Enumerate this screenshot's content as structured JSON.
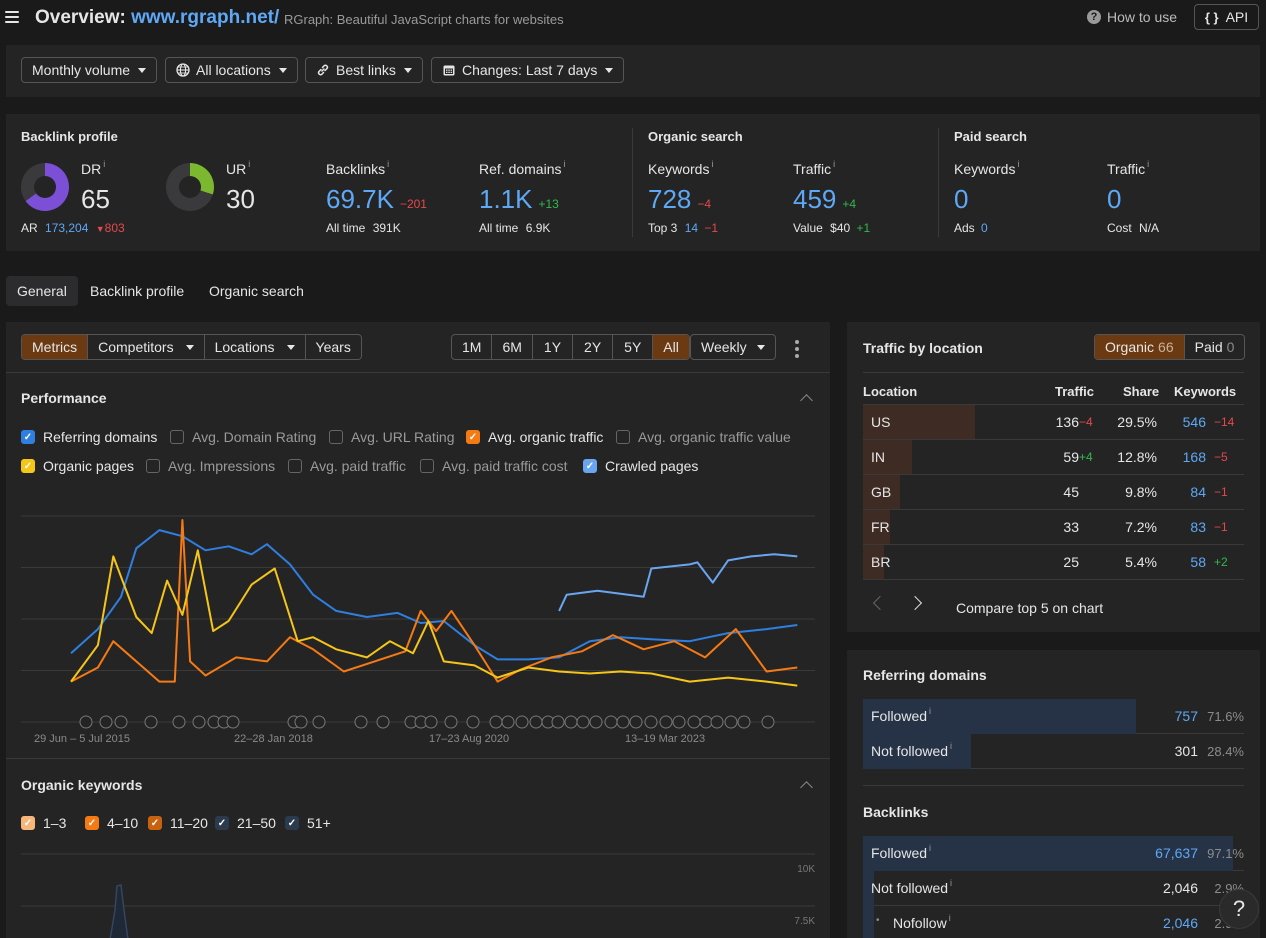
{
  "header": {
    "title_prefix": "Overview: ",
    "url": "www.rgraph.net/",
    "subtitle": "RGraph: Beautiful JavaScript charts for websites",
    "how_to_use": "How to use",
    "api": "API"
  },
  "filters": {
    "volume": "Monthly volume",
    "locations": "All locations",
    "links": "Best links",
    "changes": "Changes: Last 7 days"
  },
  "backlink_profile": {
    "title": "Backlink profile",
    "dr": {
      "label": "DR",
      "value": "65",
      "fill": 0.65
    },
    "ar": {
      "label": "AR",
      "value": "173,204",
      "change": "803"
    },
    "ur": {
      "label": "UR",
      "value": "30",
      "fill": 0.3
    },
    "backlinks": {
      "label": "Backlinks",
      "value": "69.7K",
      "change": "−201",
      "sub_label": "All time",
      "sub_value": "391K"
    },
    "ref_domains": {
      "label": "Ref. domains",
      "value": "1.1K",
      "change": "+13",
      "sub_label": "All time",
      "sub_value": "6.9K"
    }
  },
  "organic_search": {
    "title": "Organic search",
    "keywords": {
      "label": "Keywords",
      "value": "728",
      "change": "−4",
      "sub_label": "Top 3",
      "sub_value": "14",
      "sub_change": "−1"
    },
    "traffic": {
      "label": "Traffic",
      "value": "459",
      "change": "+4",
      "sub_label": "Value",
      "sub_value": "$40",
      "sub_change": "+1"
    }
  },
  "paid_search": {
    "title": "Paid search",
    "keywords": {
      "label": "Keywords",
      "value": "0",
      "sub_label": "Ads",
      "sub_value": "0"
    },
    "traffic": {
      "label": "Traffic",
      "value": "0",
      "sub_label": "Cost",
      "sub_value": "N/A"
    }
  },
  "tabs": [
    "General",
    "Backlink profile",
    "Organic search"
  ],
  "chart_toolbar": {
    "modes": [
      "Metrics",
      "Competitors",
      "Locations",
      "Years"
    ],
    "ranges": [
      "1M",
      "6M",
      "1Y",
      "2Y",
      "5Y",
      "All"
    ],
    "active_range": "All",
    "interval": "Weekly"
  },
  "performance": {
    "title": "Performance",
    "metrics": [
      {
        "label": "Referring domains",
        "checked": true,
        "color": "#2f7fe0"
      },
      {
        "label": "Avg. Domain Rating",
        "checked": false
      },
      {
        "label": "Avg. URL Rating",
        "checked": false
      },
      {
        "label": "Avg. organic traffic",
        "checked": true,
        "color": "#f57a14"
      },
      {
        "label": "Avg. organic traffic value",
        "checked": false
      },
      {
        "label": "Organic pages",
        "checked": true,
        "color": "#f5c518"
      },
      {
        "label": "Avg. Impressions",
        "checked": false
      },
      {
        "label": "Avg. paid traffic",
        "checked": false
      },
      {
        "label": "Avg. paid traffic cost",
        "checked": false
      },
      {
        "label": "Crawled pages",
        "checked": true,
        "color": "#6aa6f0"
      }
    ]
  },
  "chart_data": {
    "type": "line",
    "title": "Performance",
    "x_tick_labels": [
      "29 Jun – 5 Jul 2015",
      "22–28 Jan 2018",
      "17–23 Aug 2020",
      "13–19 Mar 2023"
    ],
    "x_range": [
      2015.45,
      2025.0
    ],
    "y_range_normalized": [
      0,
      1
    ],
    "grid": true,
    "legend": "top",
    "series": [
      {
        "name": "Referring domains",
        "color": "#2f7fe0",
        "x": [
          2015.45,
          2015.8,
          2016.1,
          2016.3,
          2016.6,
          2016.9,
          2017.2,
          2017.5,
          2017.8,
          2018.0,
          2018.3,
          2018.6,
          2018.9,
          2019.3,
          2019.7,
          2020.0,
          2020.3,
          2020.7,
          2021.0,
          2021.4,
          2021.8,
          2022.2,
          2022.6,
          2023.0,
          2023.5,
          2024.0,
          2024.5,
          2024.9
        ],
        "y": [
          0.34,
          0.46,
          0.62,
          0.86,
          0.95,
          0.92,
          0.85,
          0.87,
          0.83,
          0.88,
          0.78,
          0.63,
          0.55,
          0.52,
          0.54,
          0.49,
          0.5,
          0.38,
          0.31,
          0.31,
          0.32,
          0.4,
          0.42,
          0.41,
          0.4,
          0.44,
          0.46,
          0.48
        ]
      },
      {
        "name": "Crawled pages",
        "color": "#6aa6f0",
        "x": [
          2021.8,
          2021.9,
          2022.3,
          2022.7,
          2022.9,
          2023.0,
          2023.5,
          2023.6,
          2023.8,
          2024.0,
          2024.3,
          2024.6,
          2024.9
        ],
        "y": [
          0.55,
          0.63,
          0.65,
          0.63,
          0.62,
          0.76,
          0.78,
          0.79,
          0.69,
          0.8,
          0.82,
          0.83,
          0.82
        ]
      },
      {
        "name": "Avg. organic traffic",
        "color": "#f57a14",
        "x": [
          2015.45,
          2015.8,
          2016.0,
          2016.3,
          2016.6,
          2016.8,
          2016.9,
          2017.0,
          2017.2,
          2017.6,
          2018.0,
          2018.3,
          2018.6,
          2019.0,
          2019.4,
          2019.8,
          2020.0,
          2020.2,
          2020.4,
          2020.7,
          2021.0,
          2021.3,
          2021.7,
          2022.1,
          2022.5,
          2022.9,
          2023.3,
          2023.7,
          2024.1,
          2024.5,
          2024.9
        ],
        "y": [
          0.2,
          0.27,
          0.4,
          0.3,
          0.2,
          0.2,
          1.0,
          0.3,
          0.23,
          0.32,
          0.3,
          0.42,
          0.36,
          0.25,
          0.3,
          0.35,
          0.55,
          0.45,
          0.55,
          0.38,
          0.2,
          0.26,
          0.32,
          0.35,
          0.43,
          0.36,
          0.4,
          0.32,
          0.46,
          0.25,
          0.27
        ]
      },
      {
        "name": "Organic pages",
        "color": "#f5c518",
        "x": [
          2015.45,
          2015.8,
          2016.0,
          2016.3,
          2016.5,
          2016.7,
          2016.9,
          2017.1,
          2017.3,
          2017.5,
          2017.8,
          2018.1,
          2018.4,
          2018.6,
          2018.9,
          2019.3,
          2019.6,
          2019.9,
          2020.1,
          2020.3,
          2020.7,
          2021.0,
          2021.4,
          2021.8,
          2022.2,
          2022.6,
          2023.0,
          2023.5,
          2024.0,
          2024.5,
          2024.9
        ],
        "y": [
          0.2,
          0.38,
          0.82,
          0.52,
          0.44,
          0.7,
          0.53,
          0.85,
          0.45,
          0.5,
          0.68,
          0.76,
          0.4,
          0.42,
          0.36,
          0.32,
          0.4,
          0.34,
          0.5,
          0.3,
          0.28,
          0.22,
          0.27,
          0.25,
          0.24,
          0.25,
          0.24,
          0.2,
          0.22,
          0.2,
          0.18
        ]
      }
    ]
  },
  "organic_keywords": {
    "title": "Organic keywords",
    "filters": [
      {
        "label": "1–3",
        "color": "#f9b67a"
      },
      {
        "label": "4–10",
        "color": "#f57a14"
      },
      {
        "label": "11–20",
        "color": "#c8620f"
      },
      {
        "label": "21–50",
        "color": "#2c3a4e"
      },
      {
        "label": "51+",
        "color": "#2c3a4e"
      }
    ],
    "y_ticks": [
      "10K",
      "7.5K"
    ]
  },
  "traffic_by_location": {
    "title": "Traffic by location",
    "organic_label": "Organic",
    "organic_count": "66",
    "paid_label": "Paid",
    "paid_count": "0",
    "columns": [
      "Location",
      "Traffic",
      "Share",
      "Keywords"
    ],
    "rows": [
      {
        "location": "US",
        "traffic": "136",
        "traffic_change": "−4",
        "traffic_change_dir": "down",
        "share": "29.5%",
        "share_value": 0.295,
        "keywords": "546",
        "keywords_change": "−14",
        "keywords_change_dir": "down"
      },
      {
        "location": "IN",
        "traffic": "59",
        "traffic_change": "+4",
        "traffic_change_dir": "up",
        "share": "12.8%",
        "share_value": 0.128,
        "keywords": "168",
        "keywords_change": "−5",
        "keywords_change_dir": "down"
      },
      {
        "location": "GB",
        "traffic": "45",
        "traffic_change": "",
        "traffic_change_dir": "",
        "share": "9.8%",
        "share_value": 0.098,
        "keywords": "84",
        "keywords_change": "−1",
        "keywords_change_dir": "down"
      },
      {
        "location": "FR",
        "traffic": "33",
        "traffic_change": "",
        "traffic_change_dir": "",
        "share": "7.2%",
        "share_value": 0.072,
        "keywords": "83",
        "keywords_change": "−1",
        "keywords_change_dir": "down"
      },
      {
        "location": "BR",
        "traffic": "25",
        "traffic_change": "",
        "traffic_change_dir": "",
        "share": "5.4%",
        "share_value": 0.054,
        "keywords": "58",
        "keywords_change": "+2",
        "keywords_change_dir": "up"
      }
    ],
    "compare_label": "Compare top 5 on chart"
  },
  "referring_domains": {
    "title": "Referring domains",
    "rows": [
      {
        "label": "Followed",
        "value": "757",
        "pct": "71.6%",
        "share": 0.716,
        "link": true
      },
      {
        "label": "Not followed",
        "value": "301",
        "pct": "28.4%",
        "share": 0.284,
        "link": false
      }
    ]
  },
  "backlinks": {
    "title": "Backlinks",
    "rows": [
      {
        "label": "Followed",
        "value": "67,637",
        "pct": "97.1%",
        "share": 0.971,
        "link": true
      },
      {
        "label": "Not followed",
        "value": "2,046",
        "pct": "2.9%",
        "share": 0.029,
        "link": false
      },
      {
        "label": "Nofollow",
        "value": "2,046",
        "pct": "2.9%",
        "share": 0.029,
        "link": true,
        "indent": true
      }
    ]
  },
  "help_label": "?"
}
